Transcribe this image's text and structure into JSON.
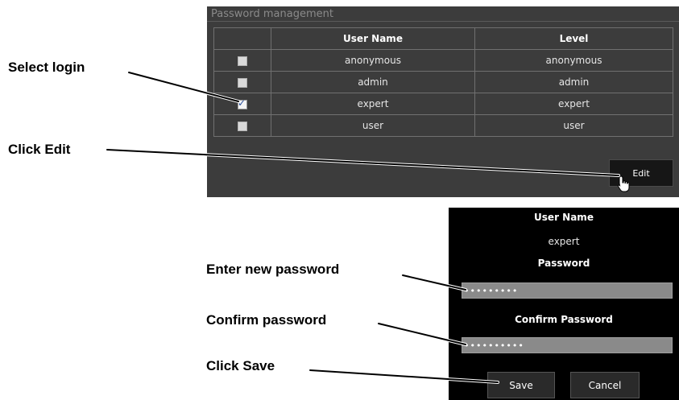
{
  "password_management": {
    "title": "Password management",
    "columns": [
      "",
      "User Name",
      "Level"
    ],
    "rows": [
      {
        "checked": false,
        "user_name": "anonymous",
        "level": "anonymous"
      },
      {
        "checked": false,
        "user_name": "admin",
        "level": "admin"
      },
      {
        "checked": true,
        "user_name": "expert",
        "level": "expert"
      },
      {
        "checked": false,
        "user_name": "user",
        "level": "user"
      }
    ],
    "edit_label": "Edit"
  },
  "edit_dialog": {
    "user_name_label": "User Name",
    "user_name_value": "expert",
    "password_label": "Password",
    "password_value": "•••••••••",
    "confirm_label": "Confirm Password",
    "confirm_value": "••••••••••",
    "save_label": "Save",
    "cancel_label": "Cancel"
  },
  "annotations": {
    "select_login": "Select login",
    "click_edit": "Click Edit",
    "enter_new_password": "Enter new password",
    "confirm_password": "Confirm password",
    "click_save": "Click Save"
  },
  "colors": {
    "panel_background": "#3c3c3c",
    "dialog_background": "#000000",
    "input_background": "#8a8a8a",
    "checkbox_tick": "#2a4f9c"
  }
}
